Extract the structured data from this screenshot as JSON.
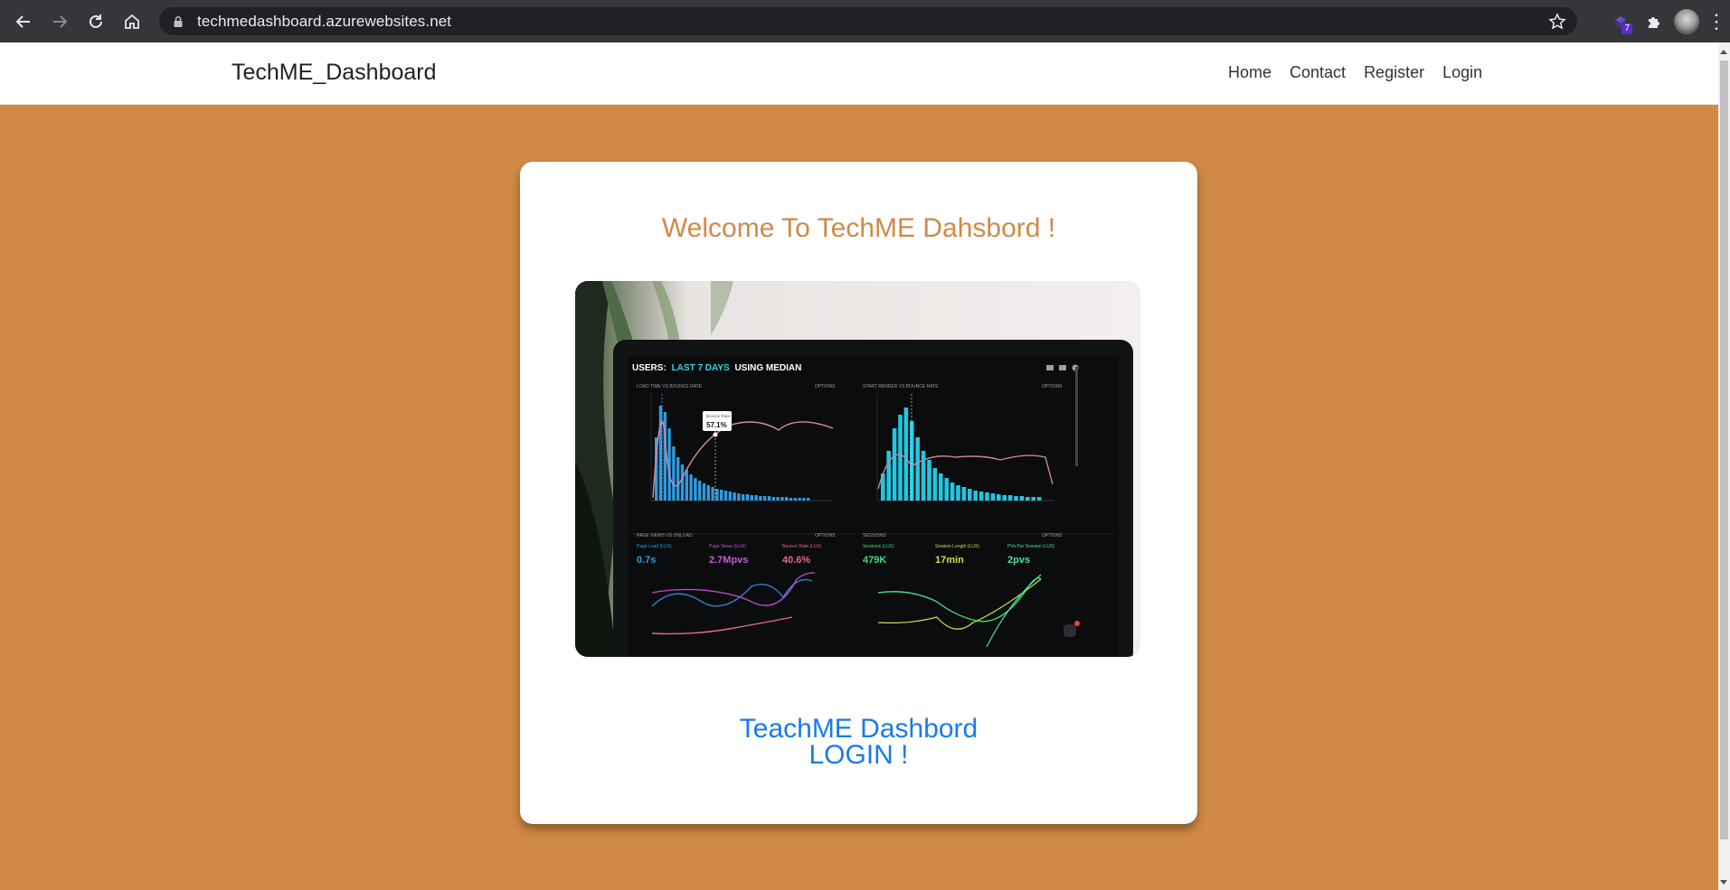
{
  "browser": {
    "url": "techmedashboard.azurewebsites.net",
    "extension_badge": "7"
  },
  "header": {
    "brand": "TechME_Dashboard",
    "nav": [
      "Home",
      "Contact",
      "Register",
      "Login"
    ]
  },
  "card": {
    "welcome": "Welcome To TechME Dahsbord !",
    "cta_line1": "TeachME Dashbord",
    "cta_line2": "LOGIN !"
  },
  "hero_image": {
    "title_prefix": "USERS:",
    "title_range": "LAST 7 DAYS",
    "title_suffix": "USING MEDIAN",
    "panel_top_left": "LOAD TIME VS BOUNCE RATE",
    "panel_top_right": "START RENDER VS BOUNCE RATE",
    "panel_bottom_left": "PAGE VIEWS VS ONLOAD",
    "panel_bottom_right": "SESSIONS",
    "options": "OPTIONS",
    "tooltip_label": "Bounce Rate",
    "tooltip_value": "57.1%",
    "stats": [
      {
        "label": "Page Load (LUX)",
        "value": "0.7s"
      },
      {
        "label": "Page Views (LUX)",
        "value": "2.7Mpvs"
      },
      {
        "label": "Bounce Rate (LUX)",
        "value": "40.6%"
      },
      {
        "label": "Sessions (LUX)",
        "value": "479K"
      },
      {
        "label": "Session Length (LUX)",
        "value": "17min"
      },
      {
        "label": "PVs Per Session (LUX)",
        "value": "2pvs"
      }
    ]
  },
  "colors": {
    "page_bg": "#D08946",
    "welcome_text": "#D08946",
    "cta_text": "#1A7AEA"
  }
}
